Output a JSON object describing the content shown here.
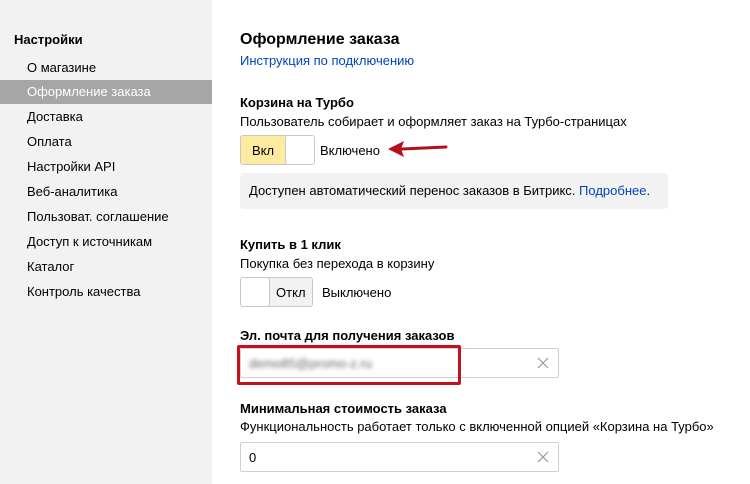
{
  "sidebar": {
    "title": "Настройки",
    "items": [
      {
        "label": "О магазине",
        "active": false
      },
      {
        "label": "Оформление заказа",
        "active": true
      },
      {
        "label": "Доставка",
        "active": false
      },
      {
        "label": "Оплата",
        "active": false
      },
      {
        "label": "Настройки API",
        "active": false
      },
      {
        "label": "Веб-аналитика",
        "active": false
      },
      {
        "label": "Пользоват. соглашение",
        "active": false
      },
      {
        "label": "Доступ к источникам",
        "active": false
      },
      {
        "label": "Каталог",
        "active": false
      },
      {
        "label": "Контроль качества",
        "active": false
      }
    ]
  },
  "main": {
    "title": "Оформление заказа",
    "help_link": "Инструкция по подключению",
    "turbo_cart": {
      "title": "Корзина на Турбо",
      "description": "Пользователь собирает и оформляет заказ на Турбо-страницах",
      "toggle_label": "Вкл",
      "status": "Включено",
      "enabled": true
    },
    "info": {
      "text": "Доступен автоматический перенос заказов в Битрикс.",
      "link": "Подробнее",
      "suffix": "."
    },
    "one_click": {
      "title": "Купить в 1 клик",
      "description": "Покупка без перехода в корзину",
      "toggle_label": "Откл",
      "status": "Выключено",
      "enabled": false
    },
    "email": {
      "title": "Эл. почта для получения заказов",
      "value": "demo85@promo-z.ru"
    },
    "min_order": {
      "title": "Минимальная стоимость заказа",
      "description": "Функциональность работает только с включенной опцией «Корзина на Турбо»",
      "value": "0"
    }
  },
  "colors": {
    "accent_toggle": "#ffeba0",
    "link": "#0044bb",
    "highlight": "#c1121f",
    "sidebar_active": "#a6a6a6"
  }
}
